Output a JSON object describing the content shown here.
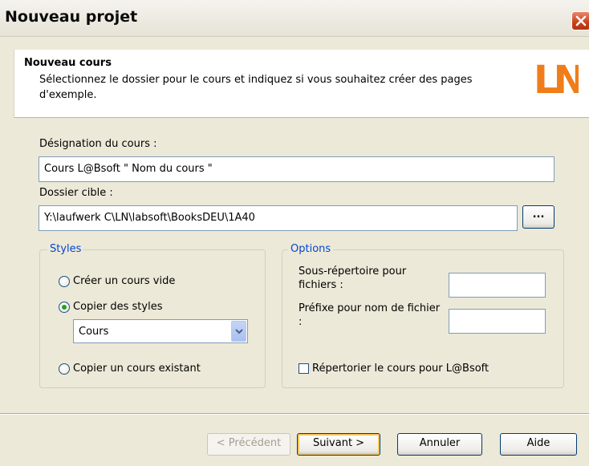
{
  "window": {
    "title": "Nouveau projet"
  },
  "header": {
    "title": "Nouveau cours",
    "description": "Sélectionnez le dossier pour le cours et indiquez si vous souhaitez créer des pages d'exemple.",
    "logo_text": "LN"
  },
  "form": {
    "course_label": "Désignation du cours :",
    "course_value": "Cours L@Bsoft \" Nom du cours \"",
    "folder_label": "Dossier cible :",
    "folder_value": "Y:\\laufwerk C\\LN\\labsoft\\BooksDEU\\1A40",
    "browse_label": "..."
  },
  "styles": {
    "legend": "Styles",
    "options": [
      {
        "label": "Créer un cours vide",
        "checked": false
      },
      {
        "label": "Copier des styles",
        "checked": true
      },
      {
        "label": "Copier un cours existant",
        "checked": false
      }
    ],
    "select_value": "Cours"
  },
  "options": {
    "legend": "Options",
    "subdir_label": "Sous-répertoire pour fichiers :",
    "subdir_value": "",
    "prefix_label": "Préfixe pour nom de fichier :",
    "prefix_value": "",
    "register_label": "Répertorier le cours pour L@Bsoft",
    "register_checked": false
  },
  "buttons": {
    "prev": "< Précédent",
    "next": "Suivant >",
    "cancel": "Annuler",
    "help": "Aide"
  },
  "colors": {
    "accent": "#0046d5",
    "logo": "#ef7d1a",
    "close": "#c8401c"
  }
}
